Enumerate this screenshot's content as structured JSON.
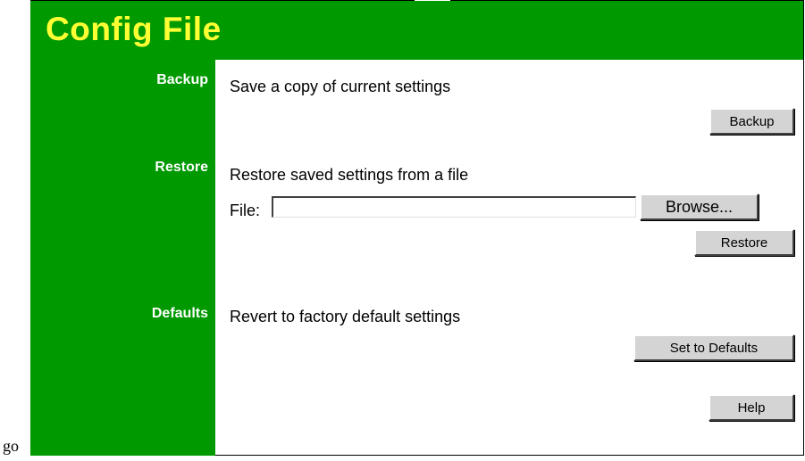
{
  "stray_text": "go",
  "header": {
    "title": "Config File"
  },
  "sections": {
    "backup": {
      "label": "Backup",
      "description": "Save a copy of current settings",
      "button": "Backup"
    },
    "restore": {
      "label": "Restore",
      "description": "Restore saved settings from a file",
      "file_label": "File:",
      "file_value": "",
      "browse_button": "Browse...",
      "button": "Restore"
    },
    "defaults": {
      "label": "Defaults",
      "description": "Revert to factory default settings",
      "button": "Set to Defaults"
    }
  },
  "help_button": "Help",
  "colors": {
    "header_bg": "#009900",
    "title": "#ffff33",
    "sidebar_text": "#ffffff",
    "button_face": "#d4d4d4"
  }
}
